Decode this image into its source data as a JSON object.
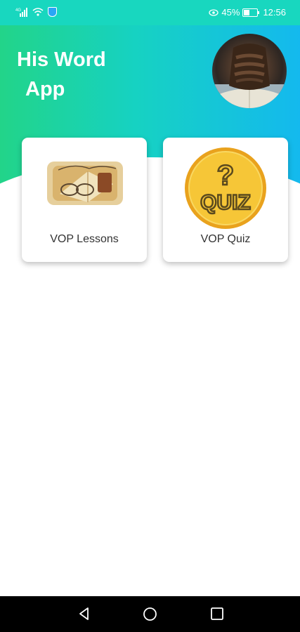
{
  "status_bar": {
    "signal_label": "4G",
    "battery_percent": "45%",
    "battery_level": 0.45,
    "time": "12:56",
    "icons": [
      "signal-icon",
      "wifi-icon",
      "shield-icon",
      "eye-icon",
      "battery-icon"
    ]
  },
  "header": {
    "title_line1": "His Word",
    "title_line2": "App",
    "gradient_colors": [
      "#22d489",
      "#16d2c2",
      "#14b9ee"
    ],
    "avatar": "praying-hands-image"
  },
  "cards": [
    {
      "label": "VOP Lessons",
      "image": "bible-study-image"
    },
    {
      "label": "VOP Quiz",
      "image": "quiz-badge-image",
      "badge_text": "QUIZ",
      "badge_symbol": "?"
    }
  ],
  "nav_bar": {
    "icons": [
      "back-icon",
      "home-icon",
      "recents-icon"
    ]
  },
  "colors": {
    "status_bar": "#18d7bf",
    "quiz_badge": "#f6c637",
    "quiz_badge_ring": "#e9a21d"
  }
}
